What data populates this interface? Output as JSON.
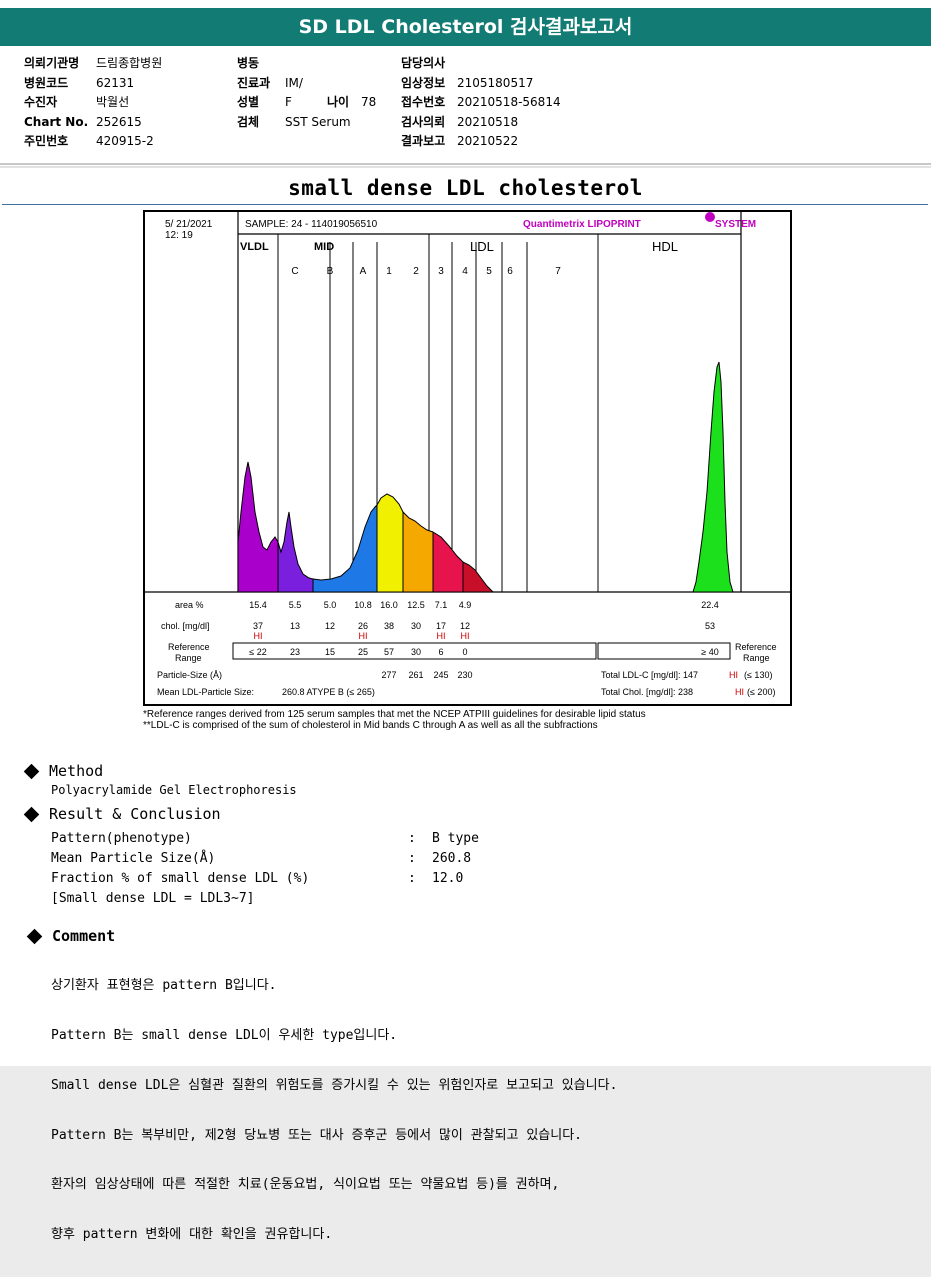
{
  "header": {
    "title": "SD LDL Cholesterol 검사결과보고서"
  },
  "patient_info": {
    "col1": [
      {
        "label": "의뢰기관명",
        "value": "드림종합병원"
      },
      {
        "label": "병원코드",
        "value": "62131"
      },
      {
        "label": "수진자",
        "value": "박월선"
      },
      {
        "label": "Chart No.",
        "value": "252615"
      },
      {
        "label": "주민번호",
        "value": "420915-2"
      }
    ],
    "col2": [
      {
        "label": "병동",
        "value": ""
      },
      {
        "label": "진료과",
        "value": "IM/"
      },
      {
        "label": "성별",
        "value": "F"
      },
      {
        "label": "검체",
        "value": "SST Serum"
      }
    ],
    "age_label": "나이",
    "age_value": "78",
    "col3": [
      {
        "label": "담당의사",
        "value": ""
      },
      {
        "label": "임상정보",
        "value": "2105180517"
      },
      {
        "label": "접수번호",
        "value": "20210518-56814"
      },
      {
        "label": "검사의뢰",
        "value": "20210518"
      },
      {
        "label": "결과보고",
        "value": "20210522"
      }
    ]
  },
  "section_title": "small dense LDL cholesterol",
  "report": {
    "date": "5/ 21/2021",
    "time": "12: 19",
    "sample": "SAMPLE:   24 - 114019056510",
    "brand": "Quantimetrix LIPOPRINT",
    "brand_suffix": "SYSTEM",
    "band_groups": [
      "VLDL",
      "MID",
      "LDL",
      "HDL"
    ],
    "bands": [
      "C",
      "B",
      "A",
      "1",
      "2",
      "3",
      "4",
      "5",
      "6",
      "7"
    ],
    "row_labels": {
      "area": "area %",
      "chol": "chol. [mg/dl]",
      "ref_line1": "Reference",
      "ref_line2": "Range",
      "ref_right1": "Reference",
      "ref_right2": "Range",
      "particle": "Particle-Size (Å)",
      "mean": "Mean LDL-Particle Size:"
    },
    "area": [
      "15.4",
      "5.5",
      "5.0",
      "10.8",
      "16.0",
      "12.5",
      "7.1",
      "4.9",
      "22.4"
    ],
    "chol": [
      "37",
      "13",
      "12",
      "26",
      "38",
      "30",
      "17",
      "12",
      "53"
    ],
    "hi_flag": "HI",
    "reference": [
      "≤ 22",
      "23",
      "15",
      "25",
      "57",
      "30",
      "6",
      "0"
    ],
    "hdl_reference": "≥  40",
    "particle_sizes": [
      "277",
      "261",
      "245",
      "230"
    ],
    "mean_size": "260.8  ATYPE B (≤ 265)",
    "total_ldl": "Total LDL-C  [mg/dl]:   147",
    "total_ldl_flag": "HI",
    "total_ldl_ref": "(≤ 130)",
    "total_chol": "Total Chol.  [mg/dl]:     238",
    "total_chol_flag": "HI",
    "total_chol_ref": "(≤ 200)"
  },
  "footnotes": [
    "*Reference ranges derived from 125 serum samples that met the NCEP ATPIII guidelines for desirable lipid status",
    "**LDL-C is comprised of the sum of cholesterol in Mid bands C through A as well as all the subfractions"
  ],
  "method": {
    "title": "Method",
    "text": "Polyacrylamide Gel Electrophoresis"
  },
  "result": {
    "title": "Result & Conclusion",
    "rows": [
      {
        "k": "Pattern(phenotype)",
        "c": ":",
        "v": "B type"
      },
      {
        "k": "Mean Particle Size(Å)",
        "c": ":",
        "v": "260.8"
      },
      {
        "k": "Fraction % of small dense LDL (%)",
        "c": ":",
        "v": "12.0"
      }
    ],
    "note": "[Small dense LDL = LDL3~7]"
  },
  "comment": {
    "title": "Comment",
    "lines": [
      "상기환자 표현형은 pattern B입니다.",
      "Pattern B는 small dense LDL이 우세한 type입니다.",
      "Small dense LDL은 심혈관 질환의 위험도를 증가시킬 수 있는 위험인자로 보고되고 있습니다.",
      "Pattern B는 복부비만, 제2형 당뇨병 또는 대사 증후군 등에서 많이 관찰되고 있습니다.",
      "환자의 임상상태에 따른 적절한 치료(운동요법, 식이요법 또는 약물요법 등)를 권하며,",
      "향후 pattern 변화에 대한 확인을 권유합니다."
    ]
  },
  "colors": {
    "header_bg": "#127c74",
    "vldl": "#aa00cc",
    "mid_c": "#7a1fdd",
    "mid_b": "#1e78e6",
    "ldl1": "#f0f000",
    "ldl2": "#f5a800",
    "ldl3": "#e6134c",
    "ldl4": "#c70f2a",
    "hdl": "#1ce01c",
    "hi": "#cc0000"
  }
}
